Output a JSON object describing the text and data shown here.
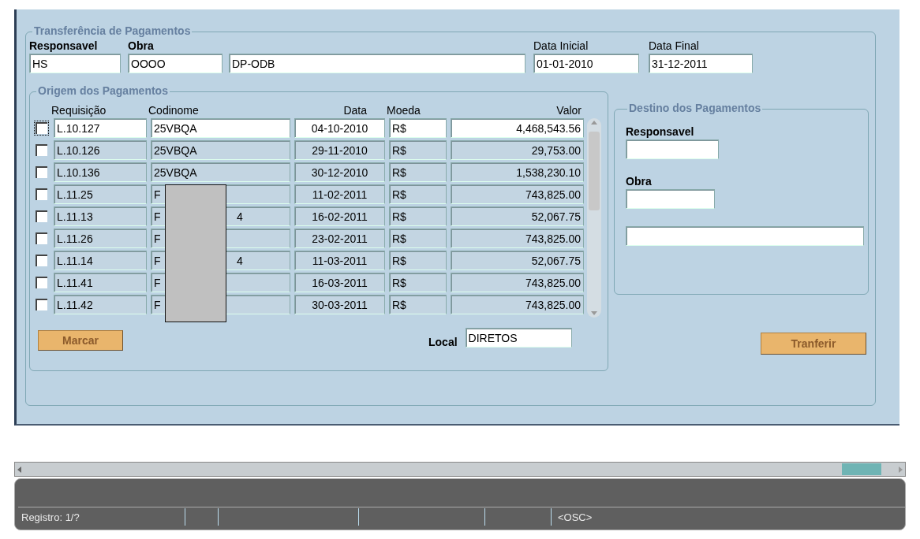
{
  "form": {
    "title": "Transferência de Pagamentos",
    "responsavel_label": "Responsavel",
    "obra_label": "Obra",
    "responsavel": "HS",
    "obra": "OOOO",
    "obra_nome": "DP-ODB",
    "data_inicial_label": "Data Inicial",
    "data_inicial": "01-01-2010",
    "data_final_label": "Data Final",
    "data_final": "31-12-2011"
  },
  "origem": {
    "title": "Origem dos Pagamentos",
    "columns": [
      "Requisição",
      "Codinome",
      "Data",
      "Moeda",
      "Valor"
    ],
    "rows": [
      {
        "checked": false,
        "selected": true,
        "requisicao": "L.10.127",
        "codinome": "25VBQA",
        "data": "04-10-2010",
        "moeda": "R$",
        "valor": "4,468,543.56"
      },
      {
        "checked": false,
        "selected": false,
        "requisicao": "L.10.126",
        "codinome": "25VBQA",
        "data": "29-11-2010",
        "moeda": "R$",
        "valor": "29,753.00"
      },
      {
        "checked": false,
        "selected": false,
        "requisicao": "L.10.136",
        "codinome": "25VBQA",
        "data": "30-12-2010",
        "moeda": "R$",
        "valor": "1,538,230.10"
      },
      {
        "checked": false,
        "selected": false,
        "requisicao": "L.11.25",
        "codinome": "F",
        "data": "11-02-2011",
        "moeda": "R$",
        "valor": "743,825.00"
      },
      {
        "checked": false,
        "selected": false,
        "requisicao": "L.11.13",
        "codinome": "F",
        "codinome_end": "4",
        "data": "16-02-2011",
        "moeda": "R$",
        "valor": "52,067.75"
      },
      {
        "checked": false,
        "selected": false,
        "requisicao": "L.11.26",
        "codinome": "F",
        "data": "23-02-2011",
        "moeda": "R$",
        "valor": "743,825.00"
      },
      {
        "checked": false,
        "selected": false,
        "requisicao": "L.11.14",
        "codinome": "F",
        "codinome_end": "4",
        "data": "11-03-2011",
        "moeda": "R$",
        "valor": "52,067.75"
      },
      {
        "checked": false,
        "selected": false,
        "requisicao": "L.11.41",
        "codinome": "F",
        "data": "16-03-2011",
        "moeda": "R$",
        "valor": "743,825.00"
      },
      {
        "checked": false,
        "selected": false,
        "requisicao": "L.11.42",
        "codinome": "F",
        "data": "30-03-2011",
        "moeda": "R$",
        "valor": "743,825.00"
      }
    ],
    "marcar_button": "Marcar",
    "local_label": "Local",
    "local": "DIRETOS"
  },
  "destino": {
    "title": "Destino dos Pagamentos",
    "responsavel_label": "Responsavel",
    "obra_label": "Obra"
  },
  "tranferir_button": "Tranferir",
  "status_bar": {
    "registro": "Registro: 1/?",
    "mode": "<OSC>"
  }
}
